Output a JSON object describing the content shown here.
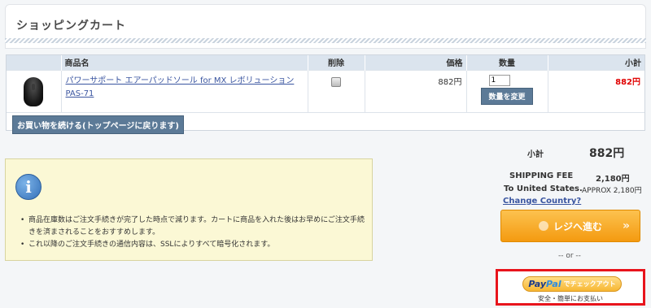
{
  "page": {
    "title": "ショッピングカート"
  },
  "table": {
    "headers": {
      "product": "商品名",
      "delete": "削除",
      "price": "価格",
      "qty": "数量",
      "subtotal": "小計"
    },
    "rows": [
      {
        "name": "パワーサポート エアーパッドソール for MX レボリューション PAS-71",
        "price": "882円",
        "qty": "1",
        "qty_button": "数量を変更",
        "subtotal": "882円",
        "image_icon": "mouse-product-icon",
        "delete_icon": "trash-icon"
      }
    ],
    "continue_button": "お買い物を続ける(トップページに戻ります)"
  },
  "info": {
    "icon": "info-icon",
    "items": [
      "商品在庫数はご注文手続きが完了した時点で減ります。カートに商品を入れた後はお早めにご注文手続きを済まされることをおすすめします。",
      "これ以降のご注文手続きの通信内容は、SSLによりすべて暗号化されます。"
    ]
  },
  "summary": {
    "subtotal_label": "小計",
    "subtotal_value": "882円",
    "shipping_label": "SHIPPING FEE",
    "shipping_value": "2,180円",
    "to_label": "To United States.",
    "approx": "APPROX 2,180円",
    "change_country": "Change Country?",
    "checkout_button": "レジへ進む",
    "or_text": "-- or --",
    "paypal": {
      "logo_p1": "Pay",
      "logo_p2": "Pal",
      "suffix": "でチェックアウト",
      "sub": "安全・簡単にお支払い"
    }
  },
  "colors": {
    "accent_button": "#5c7a97",
    "checkout_orange": "#f49a10",
    "subtotal_red": "#e00000",
    "highlight_border": "#e8141c"
  }
}
